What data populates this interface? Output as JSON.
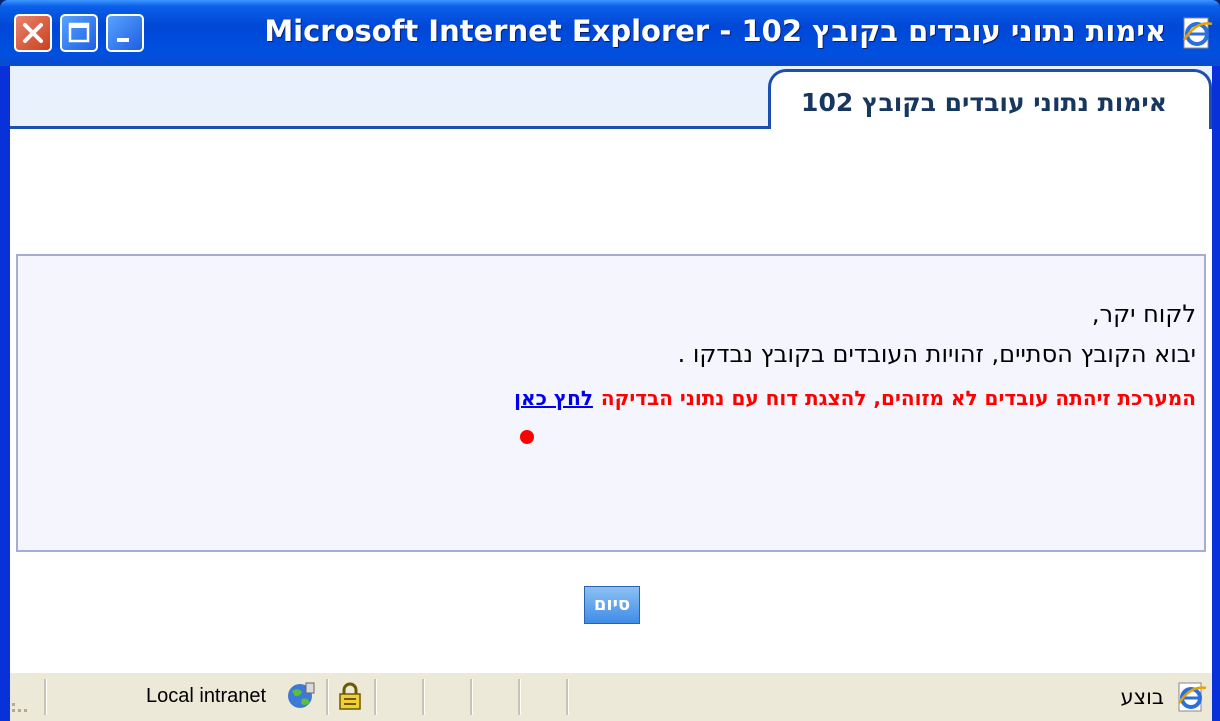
{
  "window": {
    "title": "אימות נתוני עובדים בקובץ 102 - Microsoft Internet Explorer"
  },
  "tab": {
    "title": "אימות נתוני עובדים בקובץ 102"
  },
  "content": {
    "greeting": "לקוח יקר,",
    "status": "יבוא הקובץ הסתיים, זהויות העובדים בקובץ נבדקו .",
    "alert_text": "המערכת זיהתה עובדים לא מזוהים, להצגת דוח עם נתוני הבדיקה",
    "alert_link": "לחץ כאן",
    "alert_color": "#ff0000",
    "link_color": "#0000ee"
  },
  "actions": {
    "finish_label": "סיום"
  },
  "statusbar": {
    "done_label": "בוצע",
    "zone_label": "Local intranet"
  },
  "icons": {
    "title_icon": "internet-explorer-icon",
    "zone_icon": "globe-icon",
    "security_icon": "lock-icon",
    "status_icon": "internet-explorer-icon"
  }
}
